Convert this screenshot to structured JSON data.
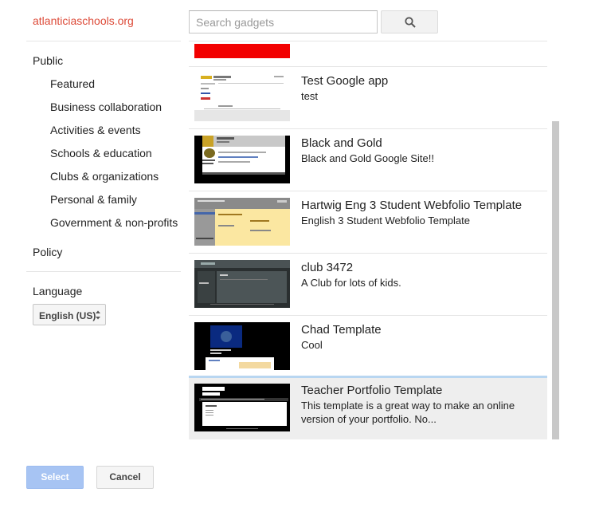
{
  "sidebar": {
    "domain": "atlanticiaschools.org",
    "public_label": "Public",
    "categories": [
      "Featured",
      "Business collaboration",
      "Activities & events",
      "Schools & education",
      "Clubs & organizations",
      "Personal & family",
      "Government & non-profits"
    ],
    "policy_label": "Policy",
    "language_label": "Language",
    "language_value": "English (US)"
  },
  "search": {
    "placeholder": "Search gadgets",
    "button_icon": "search-icon"
  },
  "templates": [
    {
      "title": "Test Google app",
      "description": "test"
    },
    {
      "title": "Black and Gold",
      "description": "Black and Gold Google Site!!"
    },
    {
      "title": "Hartwig Eng 3 Student Webfolio Template",
      "description": "English 3 Student Webfolio Template"
    },
    {
      "title": "club 3472",
      "description": "A Club for lots of kids."
    },
    {
      "title": "Chad Template",
      "description": "Cool"
    },
    {
      "title": "Teacher Portfolio Template",
      "description": "This template is a great way to make an online version of your portfolio. No..."
    }
  ],
  "footer": {
    "select_label": "Select",
    "cancel_label": "Cancel"
  },
  "colors": {
    "domain": "#dd4b39",
    "select_button": "#a7c4f3",
    "selected_row": "#eeeeee",
    "selection_border": "#b8d6f1"
  }
}
